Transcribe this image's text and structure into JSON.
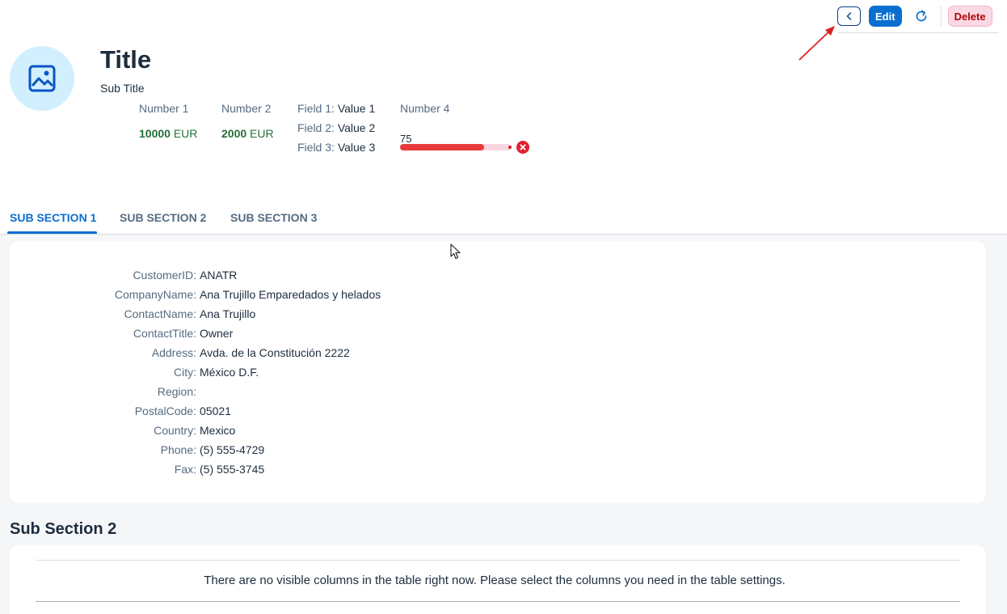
{
  "toolbar": {
    "back_icon": "chevron-left-icon",
    "edit_label": "Edit",
    "refresh_icon": "refresh-icon",
    "delete_label": "Delete"
  },
  "header": {
    "avatar_icon": "image-placeholder-icon",
    "title": "Title",
    "subtitle": "Sub Title",
    "kpis": [
      {
        "label": "Number 1",
        "value": "10000",
        "unit": "EUR"
      },
      {
        "label": "Number 2",
        "value": "2000",
        "unit": "EUR"
      }
    ],
    "fields": [
      {
        "label": "Field 1:",
        "value": "Value 1"
      },
      {
        "label": "Field 2:",
        "value": "Value 2"
      },
      {
        "label": "Field 3:",
        "value": "Value 3"
      }
    ],
    "progress": {
      "label": "Number 4",
      "value": "75",
      "percent": 75,
      "status": "error",
      "status_icon": "error-icon"
    }
  },
  "tabs": [
    {
      "label": "SUB SECTION 1",
      "active": true
    },
    {
      "label": "SUB SECTION 2",
      "active": false
    },
    {
      "label": "SUB SECTION 3",
      "active": false
    }
  ],
  "section1": {
    "rows": [
      {
        "label": "CustomerID:",
        "value": "ANATR"
      },
      {
        "label": "CompanyName:",
        "value": "Ana Trujillo Emparedados y helados"
      },
      {
        "label": "ContactName:",
        "value": "Ana Trujillo"
      },
      {
        "label": "ContactTitle:",
        "value": "Owner"
      },
      {
        "label": "Address:",
        "value": "Avda. de la Constitución 2222"
      },
      {
        "label": "City:",
        "value": "México D.F."
      },
      {
        "label": "Region:",
        "value": ""
      },
      {
        "label": "PostalCode:",
        "value": "05021"
      },
      {
        "label": "Country:",
        "value": "Mexico"
      },
      {
        "label": "Phone:",
        "value": "(5) 555-4729"
      },
      {
        "label": "Fax:",
        "value": "(5) 555-3745"
      }
    ]
  },
  "section2": {
    "title": "Sub Section 2",
    "empty_message": "There are no visible columns in the table right now. Please select the columns you need in the table settings."
  },
  "colors": {
    "accent": "#0a6ed1",
    "positive": "#256f3a",
    "negative": "#e83a3a",
    "annotation": "#e02020"
  }
}
